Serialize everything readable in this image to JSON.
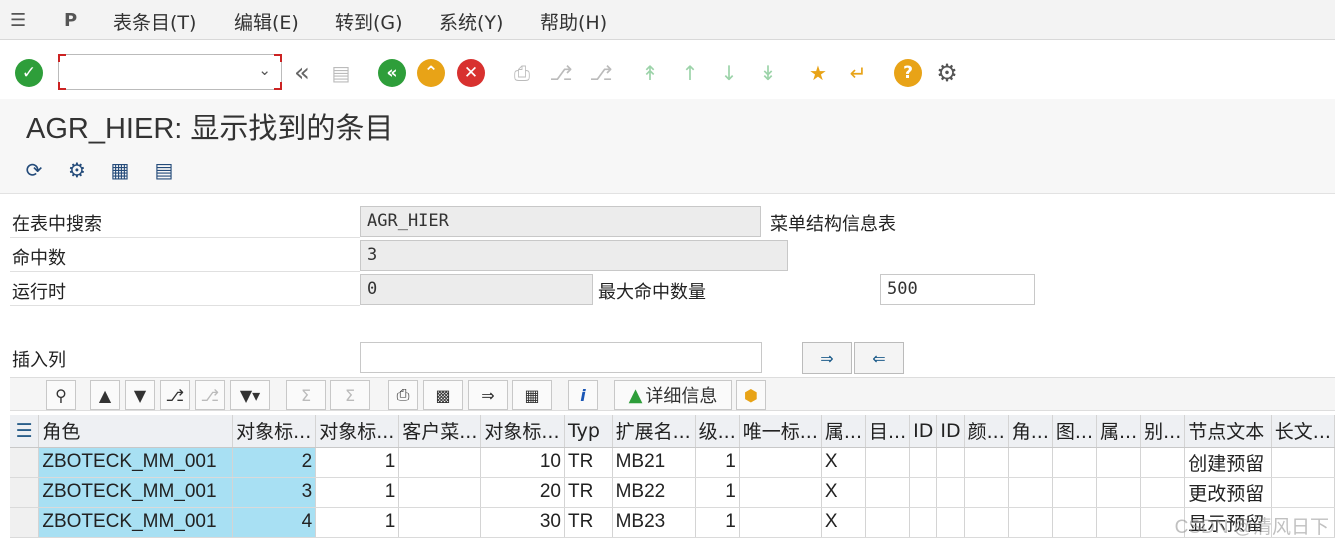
{
  "menu": {
    "items": [
      "表条目(T)",
      "编辑(E)",
      "转到(G)",
      "系统(Y)",
      "帮助(H)"
    ]
  },
  "toolbar": {
    "command_value": ""
  },
  "title": "AGR_HIER: 显示找到的条目",
  "search": {
    "table_label": "在表中搜索",
    "table_value": "AGR_HIER",
    "table_desc": "菜单结构信息表",
    "hits_label": "命中数",
    "hits_value": "3",
    "runtime_label": "运行时",
    "runtime_value": "0",
    "max_hits_label": "最大命中数量",
    "max_hits_value": "500",
    "insert_col_label": "插入列",
    "insert_col_value": ""
  },
  "alv": {
    "detail_label": "详细信息"
  },
  "grid": {
    "columns": [
      "角色",
      "对象标...",
      "对象标...",
      "客户菜...",
      "对象标...",
      "Typ",
      "扩展名...",
      "级...",
      "唯一标...",
      "属...",
      "目...",
      "ID",
      "ID",
      "颜...",
      "角...",
      "图...",
      "属...",
      "别...",
      "节点文本",
      "长文..."
    ],
    "rows": [
      [
        "ZBOTECK_MM_001",
        "2",
        "1",
        "",
        "10",
        "TR",
        "MB21",
        "1",
        "",
        "X",
        "",
        "",
        "",
        "",
        "",
        "",
        "",
        "",
        "创建预留",
        ""
      ],
      [
        "ZBOTECK_MM_001",
        "3",
        "1",
        "",
        "20",
        "TR",
        "MB22",
        "1",
        "",
        "X",
        "",
        "",
        "",
        "",
        "",
        "",
        "",
        "",
        "更改预留",
        ""
      ],
      [
        "ZBOTECK_MM_001",
        "4",
        "1",
        "",
        "30",
        "TR",
        "MB23",
        "1",
        "",
        "X",
        "",
        "",
        "",
        "",
        "",
        "",
        "",
        "",
        "显示预留",
        ""
      ]
    ]
  },
  "watermark": "CSDN @清风日下"
}
